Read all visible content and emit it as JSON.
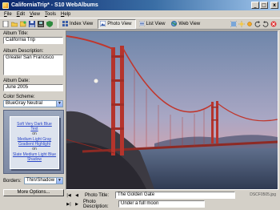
{
  "window": {
    "title": "CaliforniaTrip* - S10 WebAlbums",
    "minimize": "_",
    "maximize": "□",
    "close": "x"
  },
  "menu": [
    {
      "key": "F",
      "rest": "ile"
    },
    {
      "key": "E",
      "rest": "dit"
    },
    {
      "key": "V",
      "rest": "iew"
    },
    {
      "key": "T",
      "rest": "ools"
    },
    {
      "key": "H",
      "rest": "elp"
    }
  ],
  "toolbar": {
    "views": [
      {
        "label": "Index View",
        "icon": "grid-icon"
      },
      {
        "label": "Photo View",
        "icon": "photo-icon",
        "active": true
      },
      {
        "label": "List View",
        "icon": "list-icon"
      },
      {
        "label": "Web View",
        "icon": "globe-icon"
      }
    ]
  },
  "album": {
    "title_label": "Album Title:",
    "title_value": "California Trip",
    "description_label": "Album Description:",
    "description_value": "Greater San Francisco",
    "date_label": "Album Date:",
    "date_value": "June 2005",
    "scheme_label": "Color Scheme:",
    "scheme_value": "BlueGray Neutral",
    "preview": {
      "link1a": "Soft Very Dark Blue",
      "link1b": "Text",
      "or1": "on",
      "link2a": "Medium Light Gray",
      "link2b": "Gradient Highlight",
      "or2": "on",
      "link3a": "Slate Medium Light Blue",
      "link3b": "Shadow"
    },
    "borders_label": "Borders:",
    "borders_value": "Thin/Shadow",
    "more_options": "More Options..."
  },
  "photo": {
    "title_label": "Photo Title:",
    "title_value": "The Golden Gate",
    "description_label": "Photo Description:",
    "description_value": "Under a full moon",
    "filename": "DSCF0505.jpg"
  },
  "colors": {
    "titlebar_start": "#0a246a",
    "bridge": "#c0362c",
    "sky_top": "#7f93b2",
    "sky_bottom": "#d9a0a8"
  }
}
